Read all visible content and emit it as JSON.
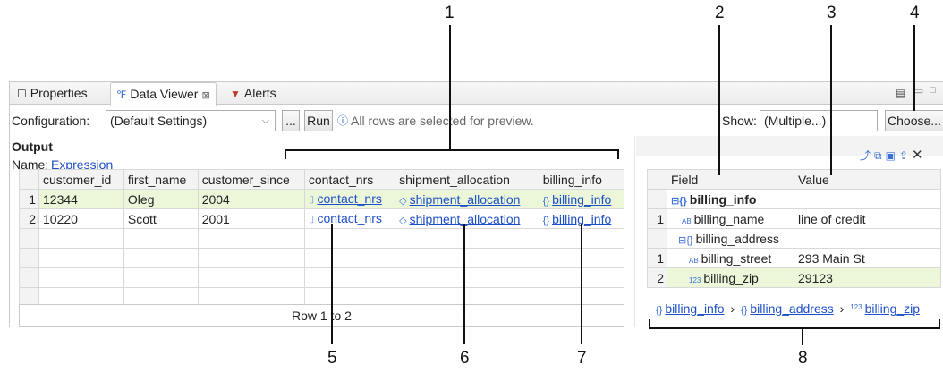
{
  "callouts": [
    "1",
    "2",
    "3",
    "4",
    "5",
    "6",
    "7",
    "8"
  ],
  "tabs": [
    {
      "label": "Properties",
      "icon": "properties-icon"
    },
    {
      "label": "Data Viewer",
      "icon": "data-viewer-icon",
      "close": "⊠"
    },
    {
      "label": "Alerts",
      "icon": "alerts-icon"
    }
  ],
  "config": {
    "label": "Configuration:",
    "value": "(Default Settings)",
    "ellipsis": "...",
    "run": "Run",
    "info": "All rows are selected for preview.",
    "show_label": "Show:",
    "show_value": "(Multiple...)",
    "choose": "Choose..."
  },
  "output": {
    "title": "Output",
    "name_label": "Name:",
    "name_value": "Expression"
  },
  "grid": {
    "columns": [
      "customer_id",
      "first_name",
      "customer_since",
      "contact_nrs",
      "shipment_allocation",
      "billing_info"
    ],
    "rows": [
      {
        "n": "1",
        "customer_id": "12344",
        "first_name": "Oleg",
        "customer_since": "2004",
        "contact_nrs": "contact_nrs",
        "shipment_allocation": "shipment_allocation",
        "billing_info": "billing_info"
      },
      {
        "n": "2",
        "customer_id": "10220",
        "first_name": "Scott",
        "customer_since": "2001",
        "contact_nrs": "contact_nrs",
        "shipment_allocation": "shipment_allocation",
        "billing_info": "billing_info"
      }
    ],
    "footer": "Row 1 to 2"
  },
  "detail": {
    "columns": [
      "Field",
      "Value"
    ],
    "rows": [
      {
        "n": "",
        "field": "billing_info",
        "value": "",
        "bold": true
      },
      {
        "n": "1",
        "field": "billing_name",
        "value": "line of credit"
      },
      {
        "n": "",
        "field": "billing_address",
        "value": ""
      },
      {
        "n": "1",
        "field": "billing_street",
        "value": "293 Main St"
      },
      {
        "n": "2",
        "field": "billing_zip",
        "value": "29123"
      }
    ],
    "breadcrumb": [
      "billing_info",
      "billing_address",
      "billing_zip"
    ],
    "sep": "›"
  },
  "colors": {
    "selected_row": "#ecf7da",
    "link": "#1d4fc7"
  }
}
